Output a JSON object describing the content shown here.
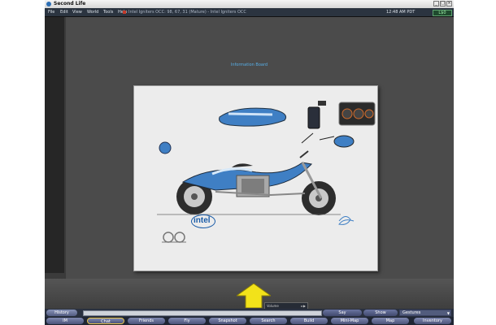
{
  "window": {
    "title": "Second Life",
    "controls": [
      "_",
      "□",
      "×"
    ]
  },
  "menu": {
    "items": [
      "File",
      "Edit",
      "View",
      "World",
      "Tools",
      "Help"
    ]
  },
  "status": {
    "parcel": "Intel Igniters OCC: 98, 67, 31 (Mature) - Intel Igniters OCC",
    "time": "12:48 AM PDT",
    "balance": "L$0"
  },
  "scene": {
    "floating_text": "Information Board"
  },
  "poster": {
    "brand": "intel"
  },
  "chat": {
    "history_label": "History",
    "input_value": "",
    "say_label": "Say",
    "show_label": "Show",
    "gestures_label": "Gestures"
  },
  "volume": {
    "label": "Volume"
  },
  "toolbar": {
    "items": [
      "IM",
      "Chat",
      "Friends",
      "Fly",
      "Snapshot",
      "Search",
      "Build",
      "Mini-Map",
      "Map",
      "Inventory"
    ],
    "active_index": 1
  },
  "colors": {
    "accent": "#e7c34a",
    "toolbar_button": "#5f6890",
    "menu_bg": "#2b3440",
    "link_text": "#58aee6"
  }
}
